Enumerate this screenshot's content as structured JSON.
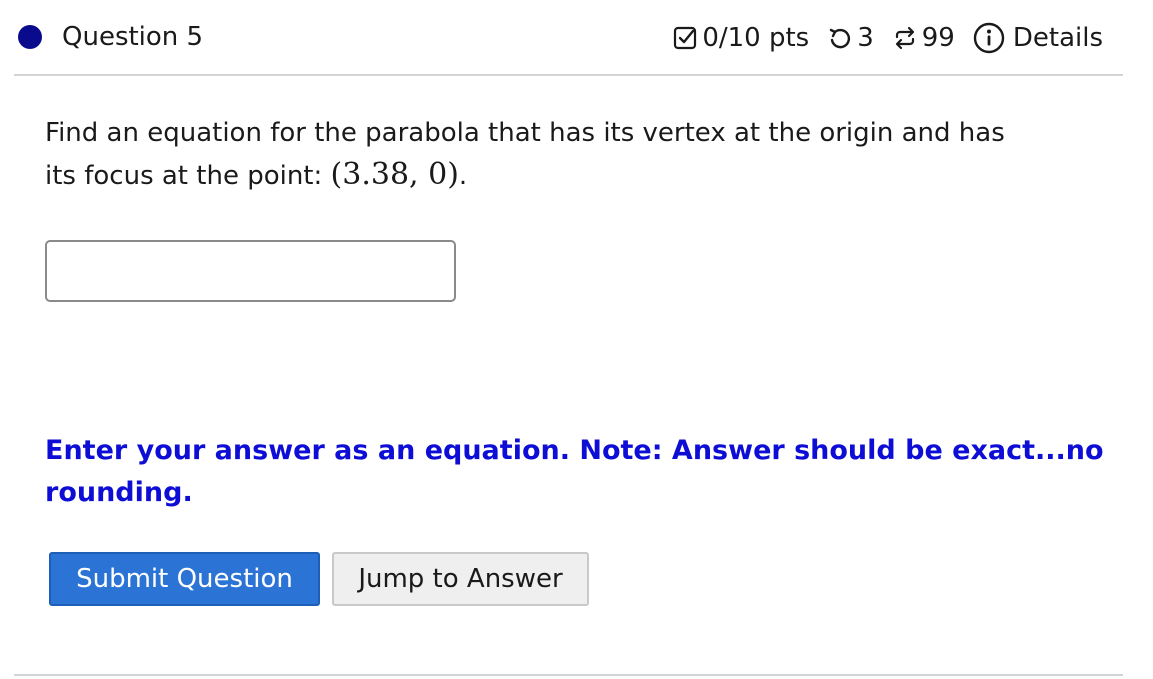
{
  "header": {
    "title": "Question 5",
    "status_color": "#0a0a8c",
    "score": "0/10 pts",
    "attempts": "3",
    "tries": "99",
    "details_label": "Details",
    "icons": [
      "checkbox-icon",
      "undo-icon",
      "retry-icon",
      "info-icon"
    ]
  },
  "question": {
    "text": "Find an equation for the parabola that has its vertex at the origin and has its focus at the point: ",
    "math": "(3.38, 0)",
    "trailing": "."
  },
  "answer": {
    "value": "",
    "placeholder": ""
  },
  "note": "Enter your answer as an equation. Note: Answer should be exact...no rounding.",
  "buttons": {
    "submit_label": "Submit Question",
    "jump_label": "Jump to Answer"
  },
  "colors": {
    "note_text": "#0d0dd6",
    "submit_bg": "#2b74d6"
  }
}
